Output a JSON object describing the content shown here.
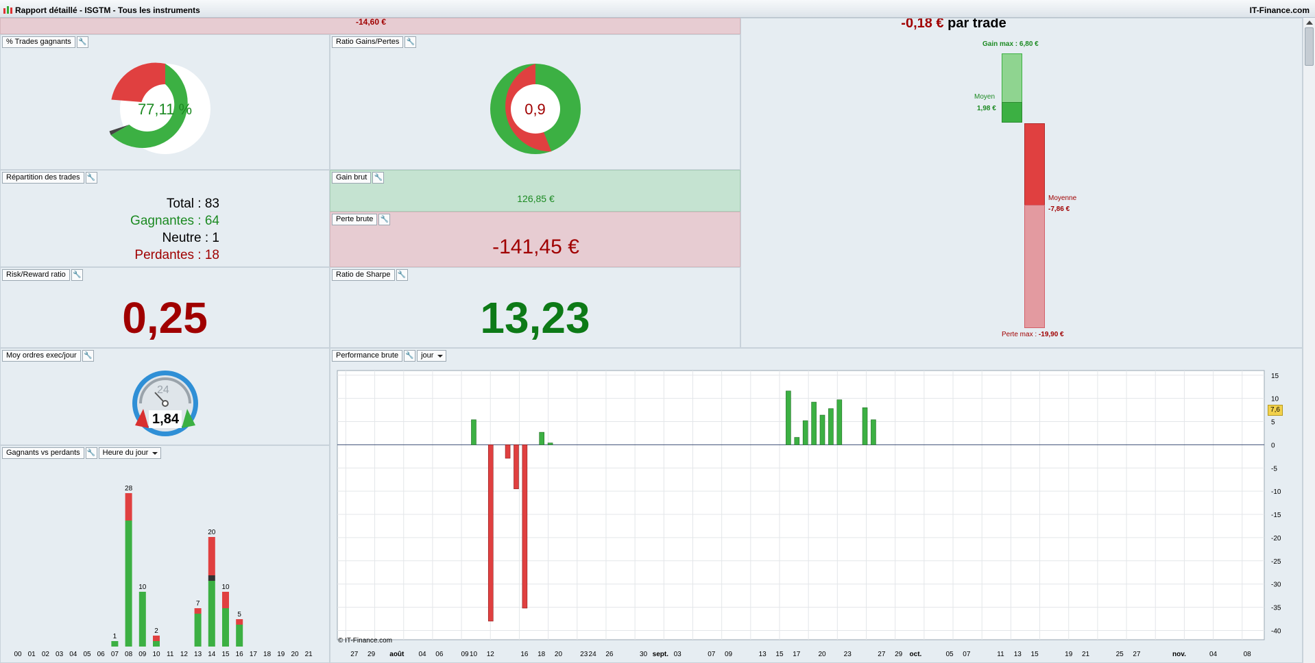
{
  "window": {
    "title": "Rapport détaillé - ISGTM - Tous les instruments",
    "brand": "IT-Finance.com",
    "app_icon": "chart-app-icon"
  },
  "top_strip": {
    "value": "-14,60 €"
  },
  "per_trade": {
    "value": "-0,18 €",
    "suffix": "par trade",
    "gain_max_label": "Gain max :",
    "gain_max_value": "6,80 €",
    "moyen_label": "Moyen",
    "moyen_value": "1,98 €",
    "moyenne_label": "Moyenne",
    "moyenne_value": "-7,86 €",
    "perte_max_label": "Perte max :",
    "perte_max_value": "-19,90 €"
  },
  "trades_gagnants": {
    "label": "% Trades gagnants",
    "value": "77,11 %",
    "fraction": 0.7711
  },
  "ratio_gains_pertes": {
    "label": "Ratio Gains/Pertes",
    "value": "0,9"
  },
  "repartition": {
    "label": "Répartition des trades",
    "total_label": "Total :",
    "total": "83",
    "gagnantes_label": "Gagnantes :",
    "gagnantes": "64",
    "neutre_label": "Neutre :",
    "neutre": "1",
    "perdantes_label": "Perdantes :",
    "perdantes": "18"
  },
  "gain_brut": {
    "label": "Gain brut",
    "value": "126,85 €"
  },
  "perte_brute": {
    "label": "Perte brute",
    "value": "-141,45 €"
  },
  "risk_reward": {
    "label": "Risk/Reward ratio",
    "value": "0,25"
  },
  "sharpe": {
    "label": "Ratio de Sharpe",
    "value": "13,23"
  },
  "ordres": {
    "label": "Moy ordres exec/jour",
    "value": "1,84",
    "dial_label": "24"
  },
  "gagnants_vs_perdants": {
    "label": "Gagnants vs perdants",
    "dropdown": "Heure du jour"
  },
  "performance": {
    "label": "Performance brute",
    "dropdown": "jour",
    "watermark": "© IT-Finance.com",
    "last_value": "7,6"
  },
  "colors": {
    "green": "#3cb043",
    "red": "#e04040",
    "dark_green": "#0d7a17",
    "dark_red": "#a00000"
  },
  "chart_data": [
    {
      "type": "bar",
      "title": "Gagnants vs perdants",
      "categories": [
        "00",
        "01",
        "02",
        "03",
        "04",
        "05",
        "06",
        "07",
        "08",
        "09",
        "10",
        "11",
        "12",
        "13",
        "14",
        "15",
        "16",
        "17",
        "18",
        "19",
        "20",
        "21"
      ],
      "series": [
        {
          "name": "Gagnants",
          "values": [
            0,
            0,
            0,
            0,
            0,
            0,
            0,
            1,
            23,
            10,
            1,
            0,
            0,
            6,
            12,
            7,
            4,
            0,
            0,
            0,
            0,
            0
          ]
        },
        {
          "name": "Neutre",
          "values": [
            0,
            0,
            0,
            0,
            0,
            0,
            0,
            0,
            0,
            0,
            0,
            0,
            0,
            0,
            1,
            0,
            0,
            0,
            0,
            0,
            0,
            0
          ]
        },
        {
          "name": "Perdants",
          "values": [
            0,
            0,
            0,
            0,
            0,
            0,
            0,
            0,
            5,
            0,
            1,
            0,
            0,
            1,
            7,
            3,
            1,
            0,
            0,
            0,
            0,
            0
          ]
        }
      ],
      "totals": [
        "",
        "",
        "",
        "",
        "",
        "",
        "",
        "1",
        "28",
        "10",
        "2",
        "",
        "",
        "7",
        "20",
        "10",
        "5",
        "",
        "",
        "",
        "",
        ""
      ]
    },
    {
      "type": "bar",
      "title": "Performance brute",
      "ylim": [
        -42,
        16
      ],
      "yticks": [
        "15",
        "10",
        "5",
        "0",
        "-5",
        "-10",
        "-15",
        "-20",
        "-25",
        "-30",
        "-35",
        "-40"
      ],
      "x_labels": [
        "27",
        "29",
        "août",
        "04",
        "06",
        "09",
        "10",
        "12",
        "16",
        "18",
        "20",
        "23",
        "24",
        "26",
        "30",
        "sept.",
        "03",
        "07",
        "09",
        "13",
        "15",
        "17",
        "20",
        "23",
        "27",
        "29",
        "oct.",
        "05",
        "07",
        "11",
        "13",
        "15",
        "19",
        "21",
        "25",
        "27",
        "nov.",
        "04",
        "08"
      ],
      "x_label_days": [
        -5,
        -3,
        0,
        3,
        5,
        8,
        9,
        11,
        15,
        17,
        19,
        22,
        23,
        25,
        29,
        31,
        33,
        37,
        39,
        43,
        45,
        47,
        50,
        53,
        57,
        59,
        61,
        65,
        67,
        71,
        73,
        75,
        79,
        81,
        85,
        87,
        92,
        96,
        100
      ],
      "bar_days": [
        13,
        14,
        15,
        9,
        17,
        18,
        11,
        46,
        47,
        48,
        49,
        50,
        51,
        52,
        55,
        56,
        66,
        67,
        80,
        101,
        104
      ],
      "bar_values": [
        -2.9,
        -9.5,
        -35.2,
        5.4,
        2.7,
        0.4,
        -38.0,
        11.6,
        1.6,
        5.2,
        9.2,
        6.4,
        7.8,
        9.7,
        8.0,
        5.4,
        0,
        0,
        0,
        0,
        0
      ]
    }
  ]
}
